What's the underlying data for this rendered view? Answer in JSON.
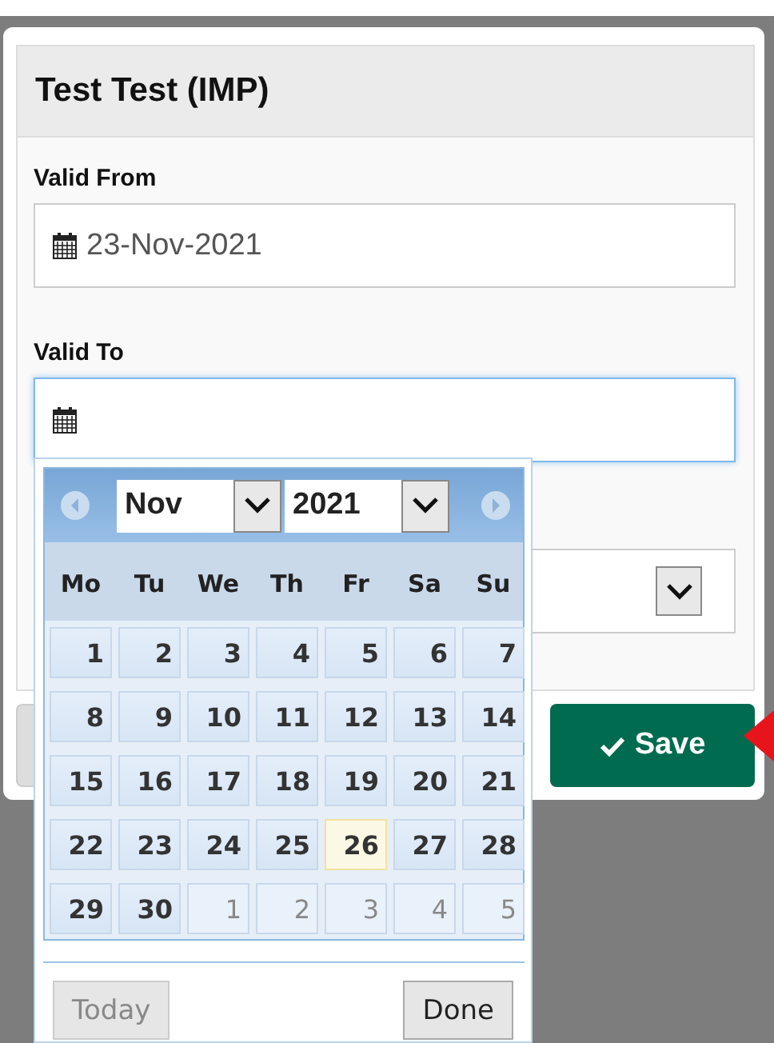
{
  "dialog": {
    "title": "Test Test (IMP)"
  },
  "fields": [
    {
      "kind": "date",
      "label": "Valid From",
      "value": "23-Nov-2021",
      "focused": false
    },
    {
      "kind": "date",
      "label": "Valid To",
      "focused": true
    },
    {
      "kind": "select"
    }
  ],
  "buttons": [
    {
      "kind": "secondary"
    },
    {
      "kind": "primary",
      "label": "Save"
    }
  ],
  "datepicker": {
    "month": "Nov",
    "year": "2021",
    "weekdays": [
      "Mo",
      "Tu",
      "We",
      "Th",
      "Fr",
      "Sa",
      "Su"
    ],
    "weeks": [
      [
        {
          "day": "1",
          "other_month": false,
          "today": false
        },
        {
          "day": "2",
          "other_month": false,
          "today": false
        },
        {
          "day": "3",
          "other_month": false,
          "today": false
        },
        {
          "day": "4",
          "other_month": false,
          "today": false
        },
        {
          "day": "5",
          "other_month": false,
          "today": false
        },
        {
          "day": "6",
          "other_month": false,
          "today": false
        },
        {
          "day": "7",
          "other_month": false,
          "today": false
        }
      ],
      [
        {
          "day": "8",
          "other_month": false,
          "today": false
        },
        {
          "day": "9",
          "other_month": false,
          "today": false
        },
        {
          "day": "10",
          "other_month": false,
          "today": false
        },
        {
          "day": "11",
          "other_month": false,
          "today": false
        },
        {
          "day": "12",
          "other_month": false,
          "today": false
        },
        {
          "day": "13",
          "other_month": false,
          "today": false
        },
        {
          "day": "14",
          "other_month": false,
          "today": false
        }
      ],
      [
        {
          "day": "15",
          "other_month": false,
          "today": false
        },
        {
          "day": "16",
          "other_month": false,
          "today": false
        },
        {
          "day": "17",
          "other_month": false,
          "today": false
        },
        {
          "day": "18",
          "other_month": false,
          "today": false
        },
        {
          "day": "19",
          "other_month": false,
          "today": false
        },
        {
          "day": "20",
          "other_month": false,
          "today": false
        },
        {
          "day": "21",
          "other_month": false,
          "today": false
        }
      ],
      [
        {
          "day": "22",
          "other_month": false,
          "today": false
        },
        {
          "day": "23",
          "other_month": false,
          "today": false
        },
        {
          "day": "24",
          "other_month": false,
          "today": false
        },
        {
          "day": "25",
          "other_month": false,
          "today": false
        },
        {
          "day": "26",
          "other_month": false,
          "today": true
        },
        {
          "day": "27",
          "other_month": false,
          "today": false
        },
        {
          "day": "28",
          "other_month": false,
          "today": false
        }
      ],
      [
        {
          "day": "29",
          "other_month": false,
          "today": false
        },
        {
          "day": "30",
          "other_month": false,
          "today": false
        },
        {
          "day": "1",
          "other_month": true,
          "today": false
        },
        {
          "day": "2",
          "other_month": true,
          "today": false
        },
        {
          "day": "3",
          "other_month": true,
          "today": false
        },
        {
          "day": "4",
          "other_month": true,
          "today": false
        },
        {
          "day": "5",
          "other_month": true,
          "today": false
        }
      ]
    ],
    "today_button": {
      "label": "Today",
      "disabled": true
    },
    "done_button": {
      "label": "Done",
      "disabled": false
    }
  }
}
